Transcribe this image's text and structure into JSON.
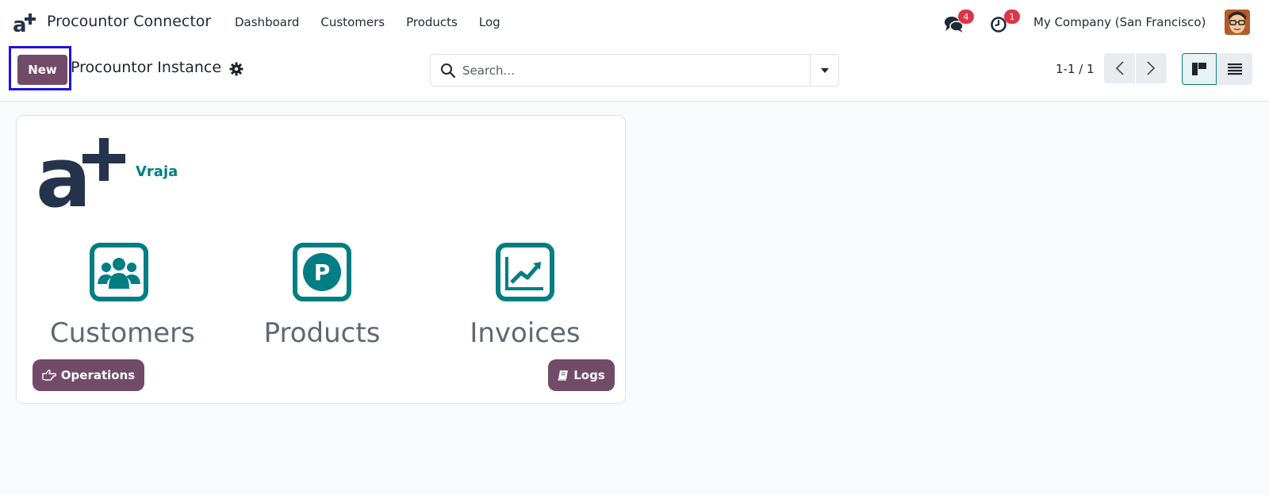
{
  "navbar": {
    "app_title": "Procountor Connector",
    "menu": [
      {
        "label": "Dashboard"
      },
      {
        "label": "Customers"
      },
      {
        "label": "Products"
      },
      {
        "label": "Log"
      }
    ],
    "messages_badge": "4",
    "activities_badge": "1",
    "company": "My Company (San Francisco)"
  },
  "control_panel": {
    "new_label": "New",
    "title": "Procountor Instance",
    "search_placeholder": "Search...",
    "pager": "1-1 / 1"
  },
  "card": {
    "name": "Vraja",
    "stats": [
      {
        "label": "Customers",
        "icon": "users-icon"
      },
      {
        "label": "Products",
        "icon": "product-p-icon"
      },
      {
        "label": "Invoices",
        "icon": "chart-line-icon"
      }
    ],
    "operations_label": "Operations",
    "logs_label": "Logs"
  },
  "colors": {
    "brand": "#714b67",
    "teal": "#017e84",
    "badge": "#dc3545",
    "highlight": "#1f10e6"
  }
}
